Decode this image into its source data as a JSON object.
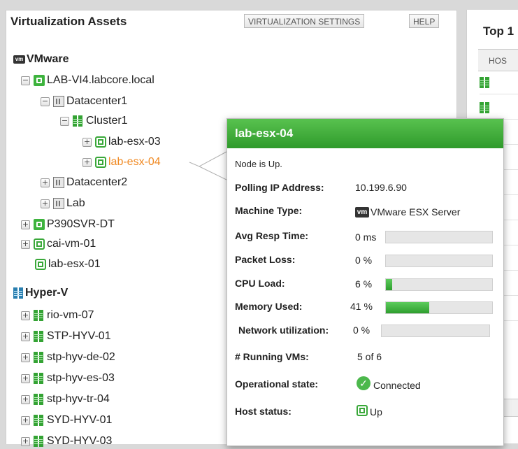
{
  "left_panel": {
    "title": "Virtualization Assets",
    "settings_button": "VIRTUALIZATION SETTINGS",
    "help_button": "HELP",
    "vmware_group": "VMware",
    "hyperv_group": "Hyper-V",
    "tree": [
      {
        "label": "LAB-VI4.labcore.local",
        "toggle": "−",
        "icon": "vcenter-icon"
      },
      {
        "label": "Datacenter1",
        "toggle": "−",
        "icon": "datacenter-icon"
      },
      {
        "label": "Cluster1",
        "toggle": "−",
        "icon": "cluster-icon"
      },
      {
        "label": "lab-esx-03",
        "toggle": "+",
        "icon": "esx-host-icon"
      },
      {
        "label": "lab-esx-04",
        "toggle": "+",
        "icon": "esx-host-icon"
      },
      {
        "label": "Datacenter2",
        "toggle": "+",
        "icon": "datacenter-icon"
      },
      {
        "label": "Lab",
        "toggle": "+",
        "icon": "datacenter-icon"
      },
      {
        "label": "P390SVR-DT",
        "toggle": "+",
        "icon": "vcenter-icon"
      },
      {
        "label": "cai-vm-01",
        "toggle": "+",
        "icon": "esx-host-icon"
      },
      {
        "label": "lab-esx-01",
        "toggle": "",
        "icon": "esx-host-icon"
      }
    ],
    "hyperv_tree": [
      {
        "label": "rio-vm-07",
        "toggle": "+",
        "icon": "hyperv-host-icon"
      },
      {
        "label": "STP-HYV-01",
        "toggle": "+",
        "icon": "hyperv-host-icon"
      },
      {
        "label": "stp-hyv-de-02",
        "toggle": "+",
        "icon": "hyperv-host-icon"
      },
      {
        "label": "stp-hyv-es-03",
        "toggle": "+",
        "icon": "hyperv-host-icon"
      },
      {
        "label": "stp-hyv-tr-04",
        "toggle": "+",
        "icon": "hyperv-host-icon"
      },
      {
        "label": "SYD-HYV-01",
        "toggle": "+",
        "icon": "hyperv-host-icon"
      },
      {
        "label": "SYD-HYV-03",
        "toggle": "+",
        "icon": "hyperv-host-icon"
      }
    ]
  },
  "right_panel": {
    "title": "Top 1",
    "column_header": "HOS",
    "title2": "p 1",
    "column_header2": "HOS"
  },
  "popup": {
    "title": "lab-esx-04",
    "node_status": "Node is Up.",
    "polling_ip_label": "Polling IP Address:",
    "polling_ip_value": "10.199.6.90",
    "machine_type_label": "Machine Type:",
    "machine_type_value": "VMware ESX Server",
    "avg_resp_label": "Avg Resp Time:",
    "avg_resp_value": "0 ms",
    "packet_loss_label": "Packet Loss:",
    "packet_loss_value": "0 %",
    "cpu_load_label": "CPU Load:",
    "cpu_load_value": "6 %",
    "cpu_load_fraction": 0.06,
    "memory_label": "Memory Used:",
    "memory_value": "41 %",
    "memory_fraction": 0.41,
    "network_label": "Network utilization:",
    "network_value": "0 %",
    "running_vms_label": "# Running VMs:",
    "running_vms_value": "5 of 6",
    "operational_label": "Operational state:",
    "operational_value": "Connected",
    "host_status_label": "Host status:",
    "host_status_value": "Up"
  },
  "colors": {
    "accent_green": "#3a9f33",
    "highlight_orange": "#f08a24"
  }
}
